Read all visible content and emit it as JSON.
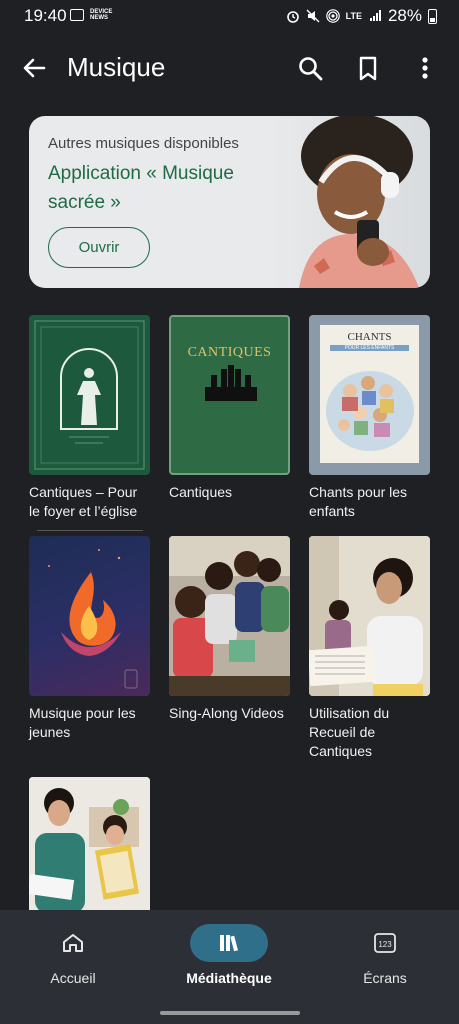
{
  "status_bar": {
    "time": "19:40",
    "news_label": "DEVICE NEWS",
    "network": "LTE",
    "battery": "28%"
  },
  "app_bar": {
    "title": "Musique",
    "icons": [
      "back-arrow-icon",
      "search-icon",
      "bookmark-icon",
      "more-vert-icon"
    ]
  },
  "banner": {
    "subtitle": "Autres musiques disponibles",
    "title": "Application « Musique sacrée »",
    "button": "Ouvrir"
  },
  "grid": [
    {
      "label": "Cantiques – Pour le foyer et l’église"
    },
    {
      "label": "Cantiques",
      "cover_text": "CANTIQUES"
    },
    {
      "label": "Chants pour les enfants",
      "cover_text": "CHANTS",
      "cover_subtext": "POUR LES ENFANTS"
    },
    {
      "label": "Musique pour les jeunes"
    },
    {
      "label": "Sing-Along Videos"
    },
    {
      "label": "Utilisation du Recueil de Cantiques"
    },
    {
      "label": ""
    }
  ],
  "bottom_nav": [
    {
      "label": "Accueil",
      "icon": "home-icon"
    },
    {
      "label": "Médiathèque",
      "icon": "library-icon",
      "active": true
    },
    {
      "label": "Écrans",
      "icon": "screens-icon",
      "badge": "123"
    }
  ],
  "colors": {
    "background": "#1f2023",
    "accent": "#1f6b47",
    "nav_active": "#2f6f89"
  }
}
